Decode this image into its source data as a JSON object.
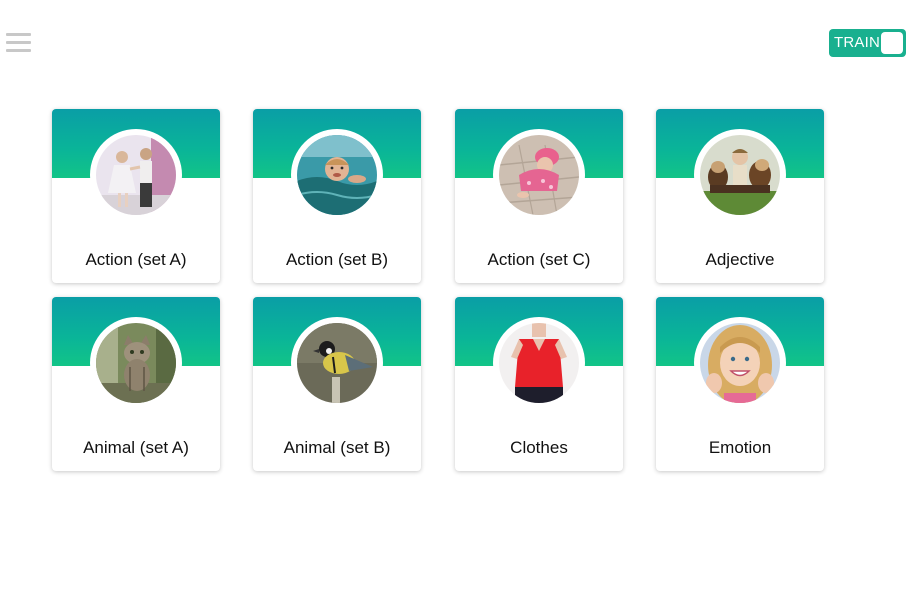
{
  "header": {
    "menu_icon": "hamburger-menu-icon",
    "train_toggle": {
      "label": "TRAIN",
      "state": "off",
      "color": "#19b08f"
    }
  },
  "theme": {
    "header_gradient_top": "#0a9ea6",
    "header_gradient_bottom": "#12c487",
    "card_background": "#ffffff",
    "text_color": "#111111"
  },
  "categories": [
    {
      "label": "Action (set A)",
      "image": "children-dancing-photo"
    },
    {
      "label": "Action (set B)",
      "image": "child-swimming-photo"
    },
    {
      "label": "Action (set C)",
      "image": "baby-crawling-photo"
    },
    {
      "label": "Adjective",
      "image": "child-with-dogs-photo"
    },
    {
      "label": "Animal (set A)",
      "image": "kitten-photo"
    },
    {
      "label": "Animal (set B)",
      "image": "bird-photo"
    },
    {
      "label": "Clothes",
      "image": "red-blouse-photo"
    },
    {
      "label": "Emotion",
      "image": "smiling-girl-photo"
    }
  ]
}
